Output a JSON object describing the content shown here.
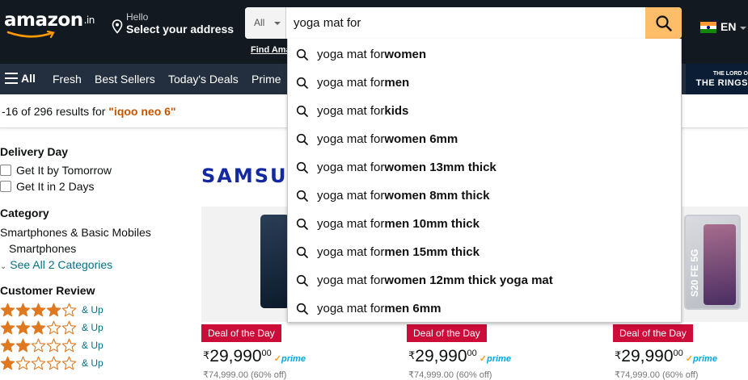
{
  "header": {
    "logo_text": "amazon",
    "logo_tld": ".in",
    "deliver_hello": "Hello",
    "deliver_address": "Select your address",
    "search_category": "All",
    "search_value": "yoga mat for",
    "find_link": "Find Ama",
    "language": "EN"
  },
  "nav": {
    "all": "All",
    "items": [
      "Fresh",
      "Best Sellers",
      "Today's Deals",
      "Prime"
    ],
    "promo_line1": "THE LORD O",
    "promo_line2": "THE RINGS"
  },
  "results": {
    "prefix": "-16 of 296 results for ",
    "query": "\"iqoo neo 6\""
  },
  "sidebar": {
    "delivery_title": "Delivery Day",
    "delivery_options": [
      "Get It by Tomorrow",
      "Get It in 2 Days"
    ],
    "category_title": "Category",
    "category_parent": "Smartphones & Basic Mobiles",
    "category_child": "Smartphones",
    "see_all": "See All 2 Categories",
    "review_title": "Customer Review",
    "review_rows": [
      {
        "stars": 4,
        "label": "& Up"
      },
      {
        "stars": 3,
        "label": "& Up"
      },
      {
        "stars": 2,
        "label": "& Up"
      },
      {
        "stars": 1,
        "label": "& Up"
      }
    ]
  },
  "main": {
    "brand_banner": "SAMSUN",
    "products": [
      {
        "badge": "Deal of the Day",
        "currency": "₹",
        "price_whole": "29,990",
        "price_frac": "00",
        "prime": "prime",
        "mrp": "₹74,999.00 (60% off)"
      },
      {
        "badge": "Deal of the Day",
        "currency": "₹",
        "price_whole": "29,990",
        "price_frac": "00",
        "prime": "prime",
        "mrp": "₹74,999.00 (60% off)"
      },
      {
        "badge": "Deal of the Day",
        "currency": "₹",
        "price_whole": "29,990",
        "price_frac": "00",
        "prime": "prime",
        "mrp": "₹74,999.00 (60% off)",
        "phone_label": "S20 FE 5G"
      }
    ]
  },
  "suggestions": [
    {
      "prefix": "yoga mat for ",
      "bold": "women"
    },
    {
      "prefix": "yoga mat for ",
      "bold": "men"
    },
    {
      "prefix": "yoga mat for ",
      "bold": "kids"
    },
    {
      "prefix": "yoga mat for ",
      "bold": "women 6mm"
    },
    {
      "prefix": "yoga mat for ",
      "bold": "women 13mm thick"
    },
    {
      "prefix": "yoga mat for ",
      "bold": "women 8mm thick"
    },
    {
      "prefix": "yoga mat for ",
      "bold": "men 10mm thick"
    },
    {
      "prefix": "yoga mat for ",
      "bold": "men 15mm thick"
    },
    {
      "prefix": "yoga mat for ",
      "bold": "women 12mm thick yoga mat"
    },
    {
      "prefix": "yoga mat for ",
      "bold": "men 6mm"
    }
  ],
  "colors": {
    "header_bg": "#131921",
    "nav_bg": "#232f3e",
    "search_button": "#febd69",
    "deal_badge": "#cc0c39",
    "link": "#007185",
    "query_highlight": "#c45500",
    "star": "#de7921"
  }
}
